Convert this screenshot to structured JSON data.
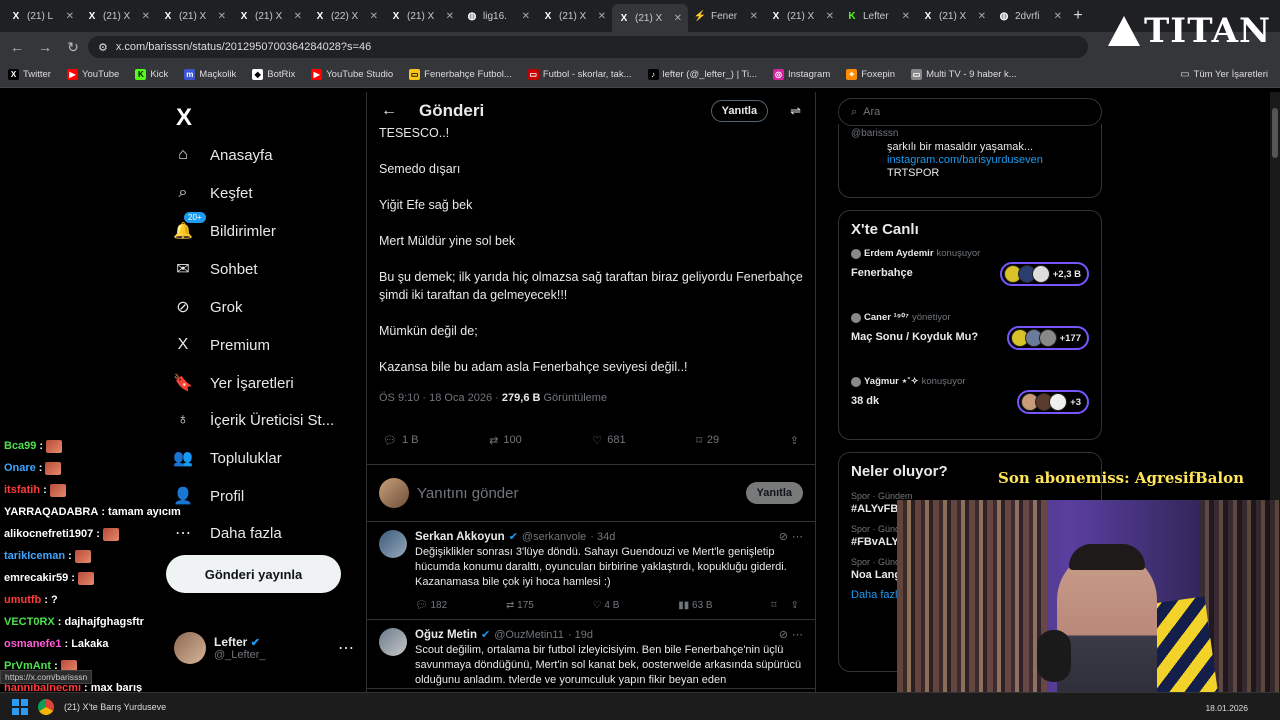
{
  "browser": {
    "tabs": [
      {
        "title": "(21) L",
        "icon": "X"
      },
      {
        "title": "(21) X",
        "icon": "X"
      },
      {
        "title": "(21) X",
        "icon": "X"
      },
      {
        "title": "(21) X",
        "icon": "X"
      },
      {
        "title": "(22) X",
        "icon": "X"
      },
      {
        "title": "(21) X",
        "icon": "X"
      },
      {
        "title": "lig16.",
        "icon": "◍"
      },
      {
        "title": "(21) X",
        "icon": "X"
      },
      {
        "title": "(21) X",
        "icon": "X"
      },
      {
        "title": "Fener",
        "icon": "⚡"
      },
      {
        "title": "(21) X",
        "icon": "X"
      },
      {
        "title": "Lefter",
        "icon": "K"
      },
      {
        "title": "(21) X",
        "icon": "X"
      },
      {
        "title": "2dvrfi",
        "icon": "◍"
      }
    ],
    "new_tab": "+",
    "url": "x.com/barisssn/status/2012950700364284028?s=46",
    "bookmarks": [
      {
        "label": "Twitter",
        "icon": "X",
        "color": "#000000"
      },
      {
        "label": "YouTube",
        "icon": "▶",
        "color": "#ff0000"
      },
      {
        "label": "Kick",
        "icon": "K",
        "color": "#53fc18"
      },
      {
        "label": "Maçkolik",
        "icon": "m",
        "color": "#3a56d4"
      },
      {
        "label": "BotRix",
        "icon": "◆",
        "color": "#ffffff"
      },
      {
        "label": "YouTube Studio",
        "icon": "▶",
        "color": "#ff0000"
      },
      {
        "label": "Fenerbahçe Futbol...",
        "icon": "▭",
        "color": "#f5c518"
      },
      {
        "label": "Futbol - skorlar, tak...",
        "icon": "▭",
        "color": "#c40000"
      },
      {
        "label": "lefter (@_lefter_) | Ti...",
        "icon": "♪",
        "color": "#000000"
      },
      {
        "label": "Instagram",
        "icon": "◎",
        "color": "#d6249f"
      },
      {
        "label": "Foxepin",
        "icon": "✦",
        "color": "#ff8c00"
      },
      {
        "label": "Multi TV - 9 haber k...",
        "icon": "▭",
        "color": "#888888"
      }
    ],
    "bookmarks_folder": "Tüm Yer İşaretleri"
  },
  "overlay": {
    "brand": "TITAN",
    "sub_banner": "Son abonemiss: AgresifBalon",
    "tooltip": "https://x.com/barisssn"
  },
  "sidebar": {
    "logo": "X",
    "notification_count": "20+",
    "items": [
      {
        "label": "Anasayfa",
        "icon": "⌂",
        "name": "home"
      },
      {
        "label": "Keşfet",
        "icon": "⌕",
        "name": "explore"
      },
      {
        "label": "Bildirimler",
        "icon": "🔔",
        "name": "notifications"
      },
      {
        "label": "Sohbet",
        "icon": "✉",
        "name": "chat"
      },
      {
        "label": "Grok",
        "icon": "⊘",
        "name": "grok"
      },
      {
        "label": "Premium",
        "icon": "X",
        "name": "premium"
      },
      {
        "label": "Yer İşaretleri",
        "icon": "🔖",
        "name": "bookmarks"
      },
      {
        "label": "İçerik Üreticisi St...",
        "icon": "♁",
        "name": "creator-studio"
      },
      {
        "label": "Topluluklar",
        "icon": "👥",
        "name": "communities"
      },
      {
        "label": "Profil",
        "icon": "👤",
        "name": "profile"
      },
      {
        "label": "Daha fazla",
        "icon": "⋯",
        "name": "more"
      }
    ],
    "post_button": "Gönderi yayınla",
    "account": {
      "name": "Lefter",
      "handle": "@_Lefter_"
    }
  },
  "main": {
    "title": "Gönderi",
    "reply_label": "Yanıtla",
    "tweet_lines": [
      "TESESCO..!",
      "Semedo dışarı",
      "Yiğit Efe sağ bek",
      "Mert Müldür yine sol bek",
      "Bu şu demek; ilk yarıda hiç olmazsa sağ taraftan biraz geliyordu Fenerbahçe şimdi iki taraftan da gelmeyecek!!!",
      "Mümkün değil de;",
      "Kazansa bile bu adam asla Fenerbahçe seviyesi değil..!"
    ],
    "meta": {
      "time": "ÖS 9:10 · 18 Oca 2026 · ",
      "views": "279,6 B",
      "views_label": " Görüntüleme"
    },
    "actions": {
      "replies": "1 B",
      "retweets": "100",
      "likes": "681",
      "bookmarks": "29"
    },
    "composer": {
      "placeholder": "Yanıtını gönder",
      "button": "Yanıtla"
    },
    "replies": [
      {
        "name": "Serkan Akkoyun",
        "handle": "@serkanvole",
        "age": "· 34d",
        "text": "Değişiklikler sonrası 3'lüye döndü. Sahayı Guendouzi ve Mert'le genişletip hücumda konumu daralttı, oyuncuları birbirine yaklaştırdı, kopukluğu giderdi. Kazanamasa bile çok iyi hoca hamlesi :)",
        "stats": {
          "replies": "182",
          "retweets": "175",
          "likes": "4 B",
          "views": "63 B"
        }
      },
      {
        "name": "Oğuz Metin",
        "handle": "@OuzMetin11",
        "age": "· 19d",
        "text": "Scout değilim, ortalama bir futbol izleyicisiyim. Ben bile Fenerbahçe'nin üçlü savunmaya döndüğünü, Mert'in sol kanat bek, oosterwelde arkasında süpürücü olduğunu anladım. tvlerde ve yorumculuk yapın fikir beyan eden",
        "stats": {
          "replies": "",
          "retweets": "",
          "likes": "",
          "views": ""
        }
      }
    ]
  },
  "right": {
    "search_placeholder": "Ara",
    "profile_card": {
      "handle": "@barisssn",
      "bio": "şarkılı bir masaldır yaşamak...",
      "link": "instagram.com/barisyurduseven",
      "extra": "TRTSPOR"
    },
    "live_title": "X'te Canlı",
    "live": [
      {
        "host": "Erdem Aydemir",
        "role": "konuşuyor",
        "title": "Fenerbahçe",
        "count": "+2,3 B"
      },
      {
        "host": "Caner ¹⁹⁰⁷",
        "role": "yönetiyor",
        "title": "Maç Sonu / Koyduk Mu?",
        "count": "+177"
      },
      {
        "host": "Yağmur ⋆˚✧",
        "role": "konuşuyor",
        "title": "38 dk",
        "count": "+3"
      }
    ],
    "trends_title": "Neler oluyor?",
    "trends": [
      {
        "category": "Spor · Gündem",
        "name": "#ALYvFB"
      },
      {
        "category": "Spor · Gündem",
        "name": "#FBvALY"
      },
      {
        "category": "Spor · Gündem",
        "name": "Noa Lang"
      }
    ],
    "show_more": "Daha fazla"
  },
  "chat": [
    {
      "user": "Bca99",
      "color": "#4be34b",
      "msg": ":"
    },
    {
      "user": "Onare",
      "color": "#3ea6ff",
      "msg": ":"
    },
    {
      "user": "itsfatih",
      "color": "#ff3b3b",
      "msg": ":"
    },
    {
      "user": "YARRAQADABRA",
      "color": "#ffffff",
      "msg": ": tamam ayıcım"
    },
    {
      "user": "alikocnefreti1907",
      "color": "#ffffff",
      "msg": ":"
    },
    {
      "user": "tarikIceman",
      "color": "#3ea6ff",
      "msg": ":"
    },
    {
      "user": "emrecakir59",
      "color": "#ffffff",
      "msg": ":"
    },
    {
      "user": "umutfb",
      "color": "#ff3b3b",
      "msg": ": ?"
    },
    {
      "user": "VECT0RX",
      "color": "#4be34b",
      "msg": ": dajhajfghagsftr"
    },
    {
      "user": "osmanefe1",
      "color": "#ff5bd6",
      "msg": ": Lakaka"
    },
    {
      "user": "PrVmAnt",
      "color": "#4be34b",
      "msg": ":"
    },
    {
      "user": "hannibalnecmi",
      "color": "#ff3b3b",
      "msg": ": max barış"
    }
  ],
  "taskbar": {
    "window_title": "(21) X'te Barış Yurduseve",
    "date": "18.01.2026"
  }
}
